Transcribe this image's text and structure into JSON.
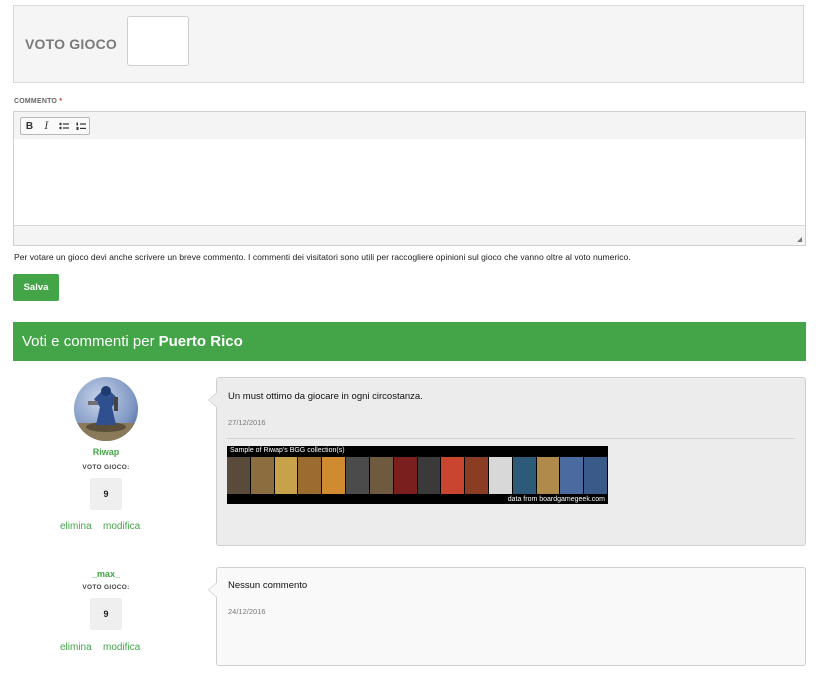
{
  "vote": {
    "label": "VOTO GIOCO"
  },
  "comment": {
    "label": "COMMENTO",
    "required": "*"
  },
  "editor": {
    "buttons": [
      "B",
      "I",
      "•≡",
      "1≡"
    ]
  },
  "help_text": "Per votare un gioco devi anche scrivere un breve commento. I commenti dei visitatori sono utili per raccogliere opinioni sul gioco che vanno oltre al voto numerico.",
  "save_label": "Salva",
  "section": {
    "prefix": "Voti e commenti per",
    "game": "Puerto Rico"
  },
  "reviews": [
    {
      "user": "Riwap",
      "voto_label": "VOTO GIOCO:",
      "score": "9",
      "delete": "elimina",
      "edit": "modifica",
      "comment": "Un must ottimo da giocare in ogni circostanza.",
      "date": "27/12/2016",
      "banner_caption": "Sample of Riwap's BGG collection(s)",
      "banner_credit": "data from boardgamegeek.com",
      "bubble_color": "#ececec"
    },
    {
      "user": "_max_",
      "voto_label": "VOTO GIOCO:",
      "score": "9",
      "delete": "elimina",
      "edit": "modifica",
      "comment": "Nessun commento",
      "date": "24/12/2016",
      "bubble_color": "#f9f9f9"
    }
  ],
  "colors": {
    "accent": "#43a548"
  }
}
